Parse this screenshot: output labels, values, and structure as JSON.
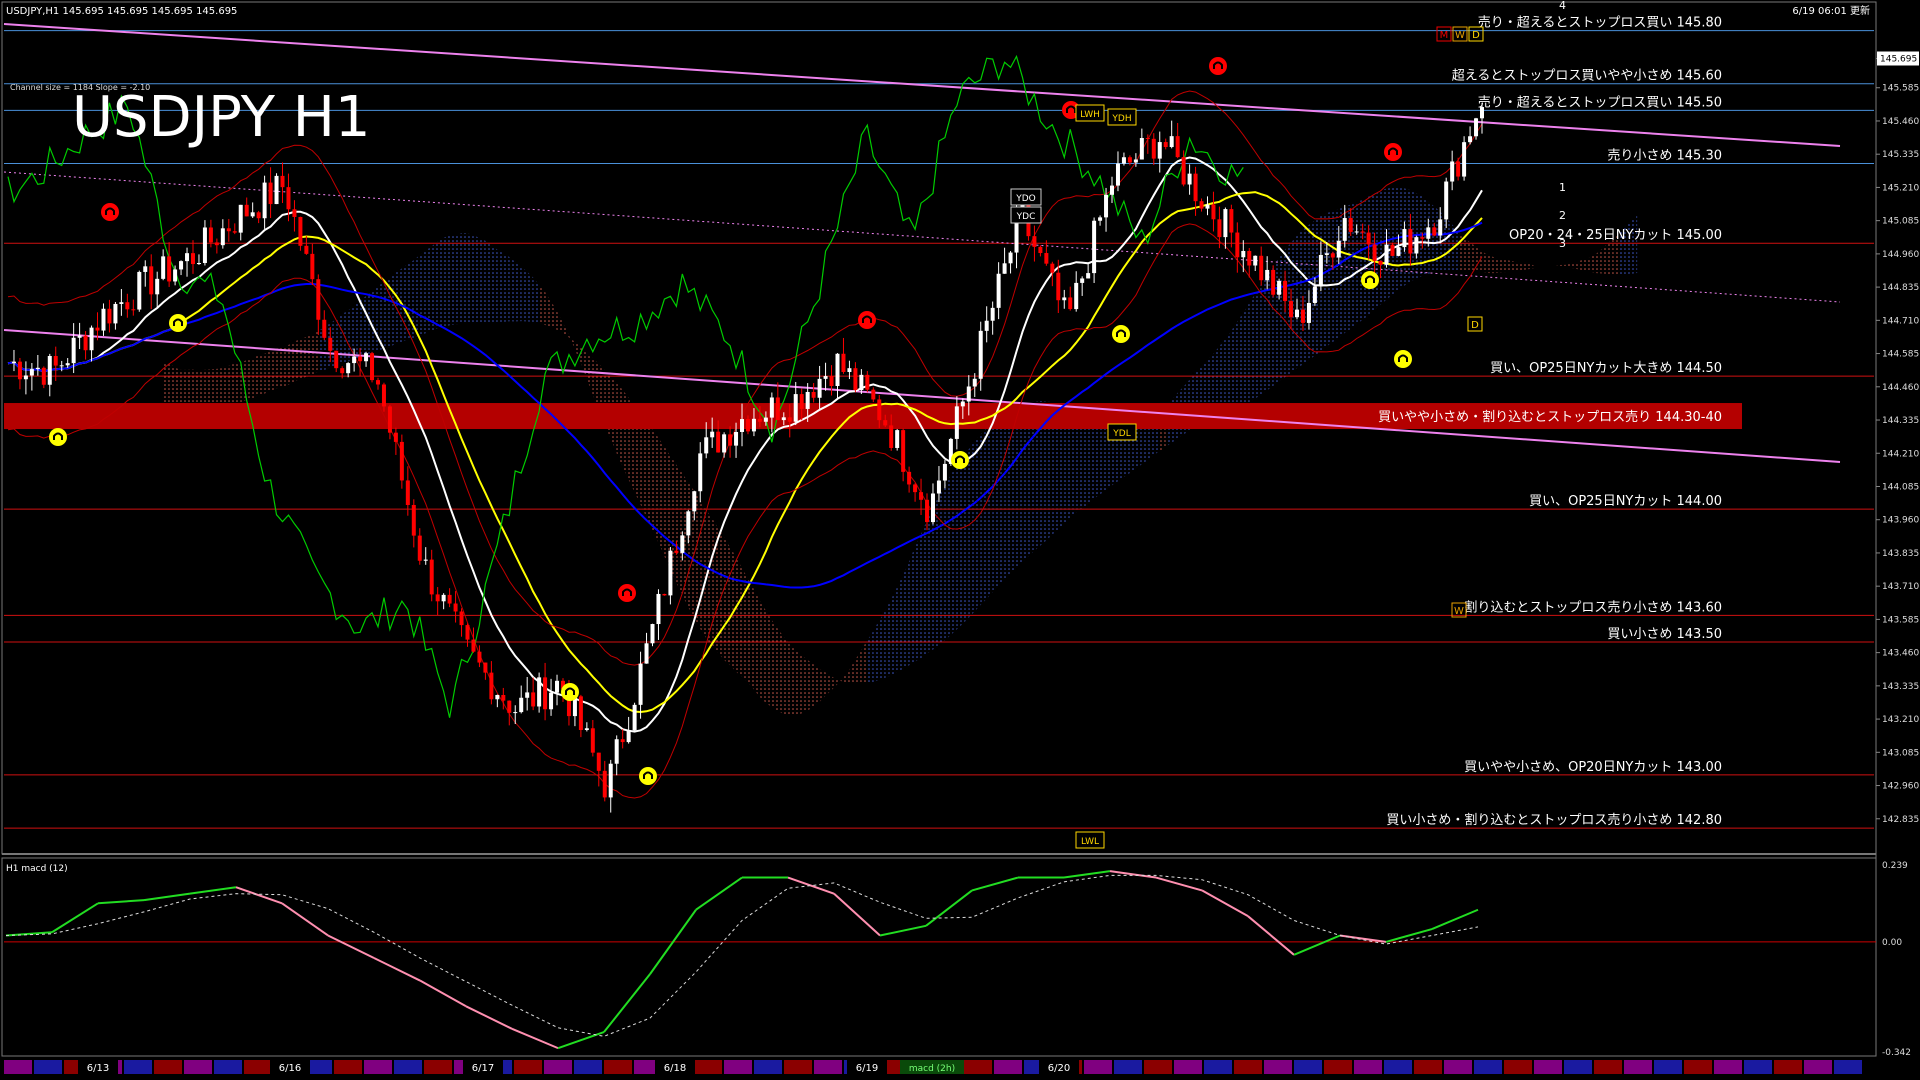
{
  "header": {
    "symbol_info": "USDJPY,H1  145.695 145.695 145.695 145.695",
    "timestamp": "6/19 06:01 更新",
    "big_title": "USDJPY H1",
    "channel_info": "Channel size = 1184 Slope = -2.10",
    "macd_label": "H1  macd (12)",
    "macd_tag": "macd (2h)"
  },
  "markers": {
    "m": "M",
    "w": "W",
    "d": "D",
    "d2": "D",
    "w2": "W"
  },
  "boxes": {
    "lwh": "LWH",
    "ydh": "YDH",
    "ydo": "YDO",
    "ydc": "YDC",
    "ydl": "YDL",
    "lwl": "LWL"
  },
  "line_nums": [
    "1",
    "2",
    "3",
    "4"
  ],
  "colors": {
    "bg": "#000000",
    "up": "#ffffff",
    "down": "#ff0000",
    "band": "#b40000",
    "channel": "#ee82ee",
    "ma_short": "#ffffff",
    "ma_mid": "#ffff00",
    "ma_long": "#0000ff",
    "lagging": "#00cc00"
  },
  "chart_data": {
    "type": "candlestick",
    "ylim": [
      142.71,
      145.9
    ],
    "y_ticks": [
      "145.695",
      "145.585",
      "145.460",
      "145.335",
      "145.210",
      "145.085",
      "144.960",
      "144.835",
      "144.710",
      "144.585",
      "144.460",
      "144.335",
      "144.210",
      "144.085",
      "143.960",
      "143.835",
      "143.710",
      "143.585",
      "143.460",
      "143.335",
      "143.210",
      "143.085",
      "142.960",
      "142.835"
    ],
    "current_price": "145.695",
    "x_dates": [
      "6/13",
      "6/16",
      "6/17",
      "6/18",
      "6/19",
      "6/20"
    ],
    "close_path": [
      144.55,
      144.52,
      144.72,
      144.85,
      144.95,
      145.1,
      145.22,
      144.6,
      144.5,
      143.8,
      143.45,
      143.25,
      143.35,
      142.95,
      143.55,
      144.2,
      144.35,
      144.4,
      144.55,
      144.35,
      144.0,
      144.55,
      145.1,
      144.7,
      145.25,
      145.4,
      145.15,
      144.95,
      144.7,
      145.1,
      144.95,
      145.1,
      145.55
    ],
    "levels": [
      {
        "price": 145.8,
        "label": "売り・超えるとストップロス買い 145.80"
      },
      {
        "price": 145.6,
        "label": "超えるとストップロス買いやや小さめ 145.60"
      },
      {
        "price": 145.5,
        "label": "売り・超えるとストップロス買い 145.50"
      },
      {
        "price": 145.3,
        "label": "売り小さめ 145.30"
      },
      {
        "price": 145.0,
        "label": "OP20・24・25日NYカット 145.00"
      },
      {
        "price": 144.5,
        "label": "買い、OP25日NYカット大きめ 144.50"
      },
      {
        "price": 144.35,
        "label": "買いやや小さめ・割り込むとストップロス売り 144.30-40"
      },
      {
        "price": 144.0,
        "label": "買い、OP25日NYカット 144.00"
      },
      {
        "price": 143.6,
        "label": "割り込むとストップロス売り小さめ 143.60"
      },
      {
        "price": 143.5,
        "label": "買い小さめ 143.50"
      },
      {
        "price": 143.0,
        "label": "買いやや小さめ、OP20日NYカット 143.00"
      },
      {
        "price": 142.8,
        "label": "買い小さめ・割り込むとストップロス売り小さめ 142.80"
      }
    ],
    "macd": {
      "ticks": [
        "0.239",
        "0.00",
        "-0.342"
      ],
      "ylim": [
        -0.342,
        0.239
      ],
      "values": [
        0.02,
        0.03,
        0.12,
        0.13,
        0.15,
        0.17,
        0.12,
        0.02,
        -0.05,
        -0.12,
        -0.2,
        -0.27,
        -0.33,
        -0.28,
        -0.1,
        0.1,
        0.2,
        0.2,
        0.15,
        0.02,
        0.05,
        0.16,
        0.2,
        0.2,
        0.22,
        0.2,
        0.16,
        0.08,
        -0.04,
        0.02,
        0.0,
        0.04,
        0.1
      ]
    }
  }
}
